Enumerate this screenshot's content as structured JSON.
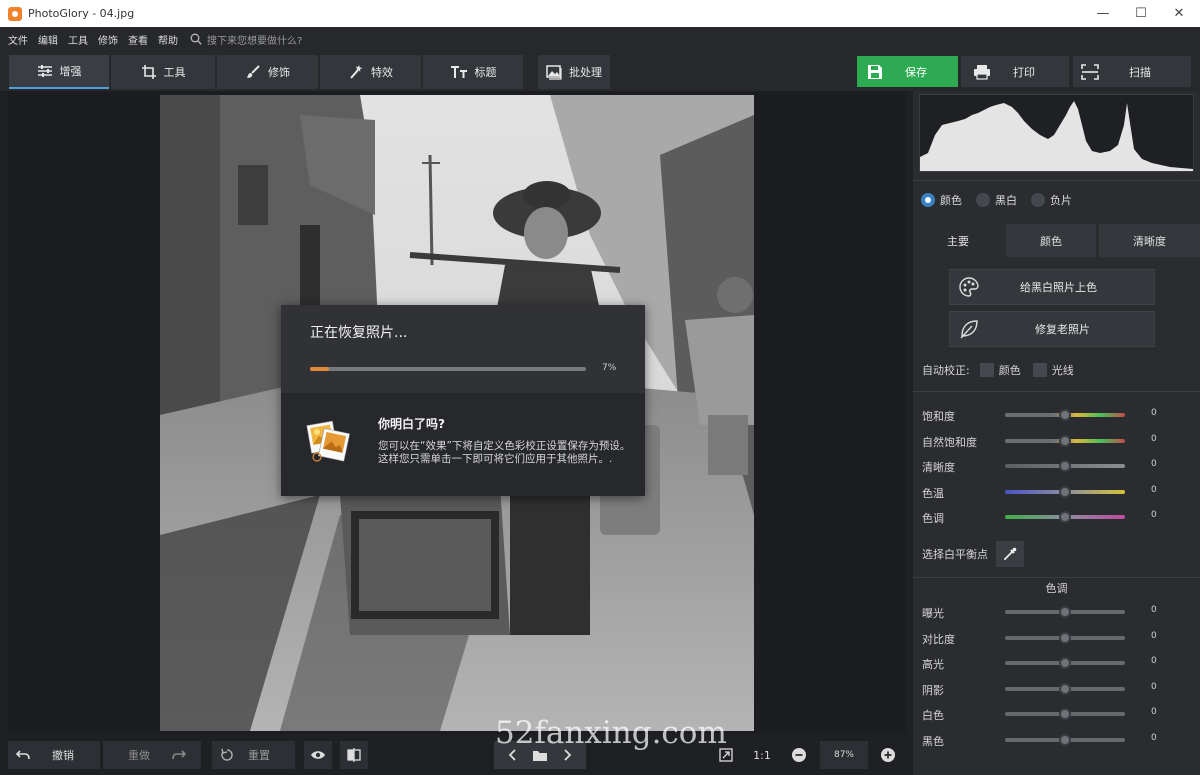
{
  "window": {
    "title": "PhotoGlory - 04.jpg",
    "controls": [
      "—",
      "☐",
      "✕"
    ]
  },
  "menu": {
    "items": [
      "文件",
      "编辑",
      "工具",
      "修饰",
      "查看",
      "帮助"
    ],
    "search_placeholder": "搜下来您想要做什么?"
  },
  "toolbar": {
    "tabs": [
      "增强",
      "工具",
      "修饰",
      "特效",
      "标题"
    ],
    "active_tab": "增强",
    "batch_label": "批处理",
    "save_label": "保存",
    "print_label": "打印",
    "scan_label": "扫描",
    "save_color": "#2eaa52"
  },
  "dialog": {
    "title": "正在恢复照片...",
    "progress": 0.07,
    "progress_text": "7%",
    "tip_title": "你明白了吗?",
    "tip_body": "您可以在“效果”下将自定义色彩校正设置保存为预设。这样您只需单击一下即可将它们应用于其他照片。.",
    "progress_color": "#e08a3a"
  },
  "bottom": {
    "undo_label": "撤销",
    "redo_label": "重做",
    "reset_label": "重置",
    "zoom_1to1": "1:1",
    "zoom_value": "87%"
  },
  "panel": {
    "color_modes": [
      "颜色",
      "黑白",
      "负片"
    ],
    "selected_mode": "颜色",
    "tabs": [
      "主要",
      "颜色",
      "清晰度"
    ],
    "active_tab": "主要",
    "colorize_label": "给黑白照片上色",
    "restore_label": "修复老照片",
    "auto_label": "自动校正:",
    "auto_color_label": "颜色",
    "auto_light_label": "光线",
    "sliders_main": [
      {
        "label": "饱和度",
        "value": "0"
      },
      {
        "label": "自然饱和度",
        "value": "0"
      },
      {
        "label": "清晰度",
        "value": "0"
      },
      {
        "label": "色温",
        "value": "0"
      },
      {
        "label": "色调",
        "value": "0"
      }
    ],
    "white_balance_label": "选择白平衡点",
    "tone_section_title": "色调",
    "sliders_tone": [
      {
        "label": "曝光",
        "value": "0"
      },
      {
        "label": "对比度",
        "value": "0"
      },
      {
        "label": "高光",
        "value": "0"
      },
      {
        "label": "阴影",
        "value": "0"
      },
      {
        "label": "白色",
        "value": "0"
      },
      {
        "label": "黑色",
        "value": "0"
      }
    ]
  },
  "watermark": "52fanxing.com"
}
